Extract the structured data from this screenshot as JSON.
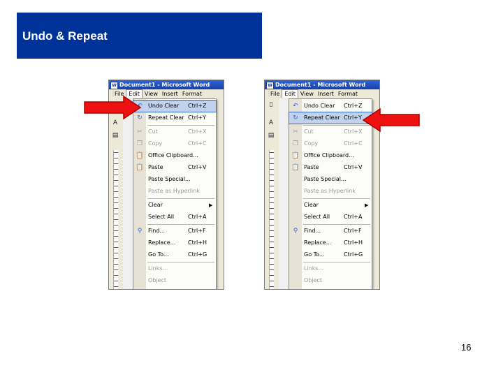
{
  "slide": {
    "title": "Undo & Repeat",
    "page_number": "16"
  },
  "window": {
    "title": "Document1 - Microsoft Word",
    "menubar": [
      "File",
      "Edit",
      "View",
      "Insert",
      "Format"
    ]
  },
  "edit_menu": {
    "items": [
      {
        "label": "Undo Clear",
        "shortcut": "Ctrl+Z",
        "icon": "undo-icon"
      },
      {
        "label": "Repeat Clear",
        "shortcut": "Ctrl+Y",
        "icon": "repeat-icon"
      },
      {
        "label": "Cut",
        "shortcut": "Ctrl+X",
        "icon": "scissors-icon"
      },
      {
        "label": "Copy",
        "shortcut": "Ctrl+C",
        "icon": "copy-icon"
      },
      {
        "label": "Office Clipboard...",
        "shortcut": "",
        "icon": "clipboard-icon"
      },
      {
        "label": "Paste",
        "shortcut": "Ctrl+V",
        "icon": "paste-icon"
      },
      {
        "label": "Paste Special...",
        "shortcut": "",
        "icon": ""
      },
      {
        "label": "Paste as Hyperlink",
        "shortcut": "",
        "icon": ""
      },
      {
        "label": "Clear",
        "shortcut": "",
        "icon": ""
      },
      {
        "label": "Select All",
        "shortcut": "Ctrl+A",
        "icon": ""
      },
      {
        "label": "Find...",
        "shortcut": "Ctrl+F",
        "icon": "binoculars-icon"
      },
      {
        "label": "Replace...",
        "shortcut": "Ctrl+H",
        "icon": ""
      },
      {
        "label": "Go To...",
        "shortcut": "Ctrl+G",
        "icon": ""
      },
      {
        "label": "Links...",
        "shortcut": "",
        "icon": ""
      },
      {
        "label": "Object",
        "shortcut": "",
        "icon": ""
      }
    ]
  },
  "colors": {
    "header_bg": "#003399",
    "highlight": "#c1d2ee",
    "arrow": "#ee1111"
  }
}
